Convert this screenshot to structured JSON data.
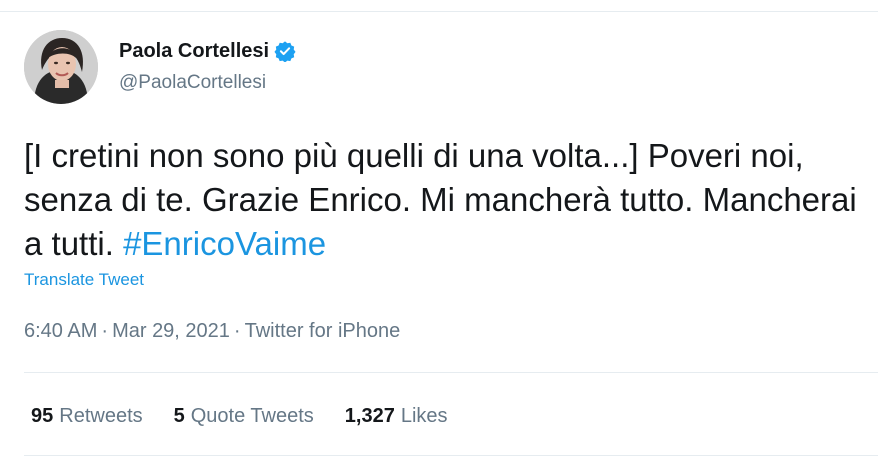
{
  "author": {
    "display_name": "Paola Cortellesi",
    "handle": "@PaolaCortellesi",
    "verified_icon": "verified-badge-icon",
    "avatar_icon": "profile-photo"
  },
  "tweet": {
    "text": "[I cretini non sono più quelli di una volta...] Poveri noi, senza di te. Grazie Enrico. Mi mancherà tutto. Mancherai a tutti.",
    "hashtag": "#EnricoVaime",
    "translate_label": "Translate Tweet"
  },
  "meta": {
    "time": "6:40 AM",
    "separator": "·",
    "date": "Mar 29, 2021",
    "source": "Twitter for iPhone"
  },
  "stats": {
    "retweets_count": "95",
    "retweets_label": "Retweets",
    "quotes_count": "5",
    "quotes_label": "Quote Tweets",
    "likes_count": "1,327",
    "likes_label": "Likes"
  },
  "colors": {
    "accent": "#1b95e0",
    "verified": "#1da1f2",
    "text_primary": "#14171a",
    "text_secondary": "#657786",
    "divider": "#e6ecf0"
  }
}
